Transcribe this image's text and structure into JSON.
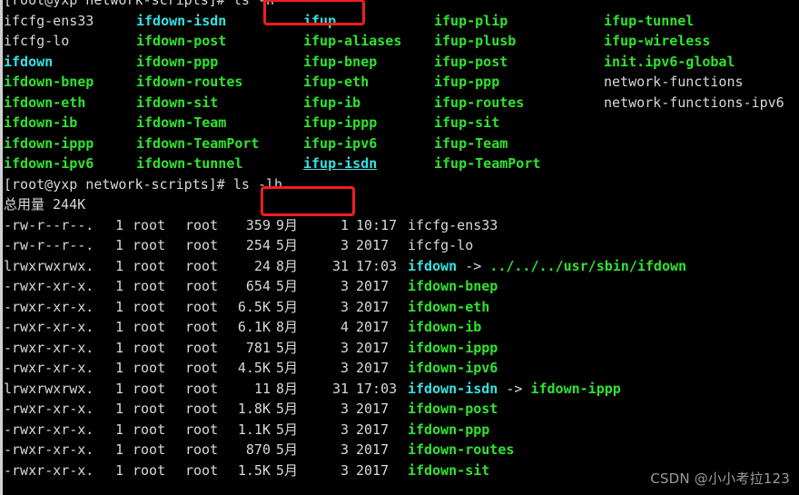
{
  "terminal": {
    "prompt_user_host": "[root@yxp network-scripts",
    "prompt_symbol": "]# ",
    "command_1": "ls -h",
    "command_2": "ls -lh",
    "total_line": "总用量 244K",
    "prompt_line_1": "[root@yxp network-scripts]# ls -h",
    "prompt_line_2": "[root@yxp network-scripts]# ls -lh"
  },
  "ls_grid": {
    "rows": [
      {
        "c1": "ifcfg-ens33",
        "c1_type": "plain",
        "c2": "ifdown-isdn",
        "c2_type": "link",
        "c3": "ifup",
        "c3_type": "link",
        "c4": "ifup-plip",
        "c4_type": "exec",
        "c5": "ifup-tunnel",
        "c5_type": "exec"
      },
      {
        "c1": "ifcfg-lo",
        "c1_type": "plain",
        "c2": "ifdown-post",
        "c2_type": "exec",
        "c3": "ifup-aliases",
        "c3_type": "exec",
        "c4": "ifup-plusb",
        "c4_type": "exec",
        "c5": "ifup-wireless",
        "c5_type": "exec"
      },
      {
        "c1": "ifdown",
        "c1_type": "link",
        "c2": "ifdown-ppp",
        "c2_type": "exec",
        "c3": "ifup-bnep",
        "c3_type": "exec",
        "c4": "ifup-post",
        "c4_type": "exec",
        "c5": "init.ipv6-global",
        "c5_type": "exec"
      },
      {
        "c1": "ifdown-bnep",
        "c1_type": "exec",
        "c2": "ifdown-routes",
        "c2_type": "exec",
        "c3": "ifup-eth",
        "c3_type": "exec",
        "c4": "ifup-ppp",
        "c4_type": "exec",
        "c5": "network-functions",
        "c5_type": "plain"
      },
      {
        "c1": "ifdown-eth",
        "c1_type": "exec",
        "c2": "ifdown-sit",
        "c2_type": "exec",
        "c3": "ifup-ib",
        "c3_type": "exec",
        "c4": "ifup-routes",
        "c4_type": "exec",
        "c5": "network-functions-ipv6",
        "c5_type": "plain"
      },
      {
        "c1": "ifdown-ib",
        "c1_type": "exec",
        "c2": "ifdown-Team",
        "c2_type": "exec",
        "c3": "ifup-ippp",
        "c3_type": "exec",
        "c4": "ifup-sit",
        "c4_type": "exec",
        "c5": "",
        "c5_type": "plain"
      },
      {
        "c1": "ifdown-ippp",
        "c1_type": "exec",
        "c2": "ifdown-TeamPort",
        "c2_type": "exec",
        "c3": "ifup-ipv6",
        "c3_type": "exec",
        "c4": "ifup-Team",
        "c4_type": "exec",
        "c5": "",
        "c5_type": "plain"
      },
      {
        "c1": "ifdown-ipv6",
        "c1_type": "exec",
        "c2": "ifdown-tunnel",
        "c2_type": "exec",
        "c3": "ifup-isdn",
        "c3_type": "link-underline",
        "c4": "ifup-TeamPort",
        "c4_type": "exec",
        "c5": "",
        "c5_type": "plain"
      }
    ]
  },
  "ls_long": {
    "rows": [
      {
        "perm": "-rw-r--r--.",
        "links": "1",
        "owner": "root",
        "group": "root",
        "size": "359",
        "month": "9月",
        "day": "1",
        "time": "10:17",
        "name": "ifcfg-ens33",
        "name_type": "plain",
        "target": ""
      },
      {
        "perm": "-rw-r--r--.",
        "links": "1",
        "owner": "root",
        "group": "root",
        "size": "254",
        "month": "5月",
        "day": "3",
        "time": "2017",
        "name": "ifcfg-lo",
        "name_type": "plain",
        "target": ""
      },
      {
        "perm": "lrwxrwxrwx.",
        "links": "1",
        "owner": "root",
        "group": "root",
        "size": "24",
        "month": "8月",
        "day": "31",
        "time": "17:03",
        "name": "ifdown",
        "name_type": "link",
        "target": "../../../usr/sbin/ifdown"
      },
      {
        "perm": "-rwxr-xr-x.",
        "links": "1",
        "owner": "root",
        "group": "root",
        "size": "654",
        "month": "5月",
        "day": "3",
        "time": "2017",
        "name": "ifdown-bnep",
        "name_type": "exec",
        "target": ""
      },
      {
        "perm": "-rwxr-xr-x.",
        "links": "1",
        "owner": "root",
        "group": "root",
        "size": "6.5K",
        "month": "5月",
        "day": "3",
        "time": "2017",
        "name": "ifdown-eth",
        "name_type": "exec",
        "target": ""
      },
      {
        "perm": "-rwxr-xr-x.",
        "links": "1",
        "owner": "root",
        "group": "root",
        "size": "6.1K",
        "month": "8月",
        "day": "4",
        "time": "2017",
        "name": "ifdown-ib",
        "name_type": "exec",
        "target": ""
      },
      {
        "perm": "-rwxr-xr-x.",
        "links": "1",
        "owner": "root",
        "group": "root",
        "size": "781",
        "month": "5月",
        "day": "3",
        "time": "2017",
        "name": "ifdown-ippp",
        "name_type": "exec",
        "target": ""
      },
      {
        "perm": "-rwxr-xr-x.",
        "links": "1",
        "owner": "root",
        "group": "root",
        "size": "4.5K",
        "month": "5月",
        "day": "3",
        "time": "2017",
        "name": "ifdown-ipv6",
        "name_type": "exec",
        "target": ""
      },
      {
        "perm": "lrwxrwxrwx.",
        "links": "1",
        "owner": "root",
        "group": "root",
        "size": "11",
        "month": "8月",
        "day": "31",
        "time": "17:03",
        "name": "ifdown-isdn",
        "name_type": "link",
        "target": "ifdown-ippp"
      },
      {
        "perm": "-rwxr-xr-x.",
        "links": "1",
        "owner": "root",
        "group": "root",
        "size": "1.8K",
        "month": "5月",
        "day": "3",
        "time": "2017",
        "name": "ifdown-post",
        "name_type": "exec",
        "target": ""
      },
      {
        "perm": "-rwxr-xr-x.",
        "links": "1",
        "owner": "root",
        "group": "root",
        "size": "1.1K",
        "month": "5月",
        "day": "3",
        "time": "2017",
        "name": "ifdown-ppp",
        "name_type": "exec",
        "target": ""
      },
      {
        "perm": "-rwxr-xr-x.",
        "links": "1",
        "owner": "root",
        "group": "root",
        "size": "870",
        "month": "5月",
        "day": "3",
        "time": "2017",
        "name": "ifdown-routes",
        "name_type": "exec",
        "target": ""
      },
      {
        "perm": "-rwxr-xr-x.",
        "links": "1",
        "owner": "root",
        "group": "root",
        "size": "1.5K",
        "month": "5月",
        "day": "3",
        "time": "2017",
        "name": "ifdown-sit",
        "name_type": "exec",
        "target": ""
      }
    ]
  },
  "annotations": {
    "highlight_color": "#f41d1d",
    "box_1_label": "# ls -h",
    "box_2_label": "# ls -lh"
  },
  "watermark": {
    "text": "CSDN @小小考拉123"
  },
  "colors": {
    "background": "#000000",
    "default_text": "#d8d8d8",
    "executable": "#2fe42f",
    "symlink": "#34e2e2",
    "highlight": "#f41d1d"
  }
}
